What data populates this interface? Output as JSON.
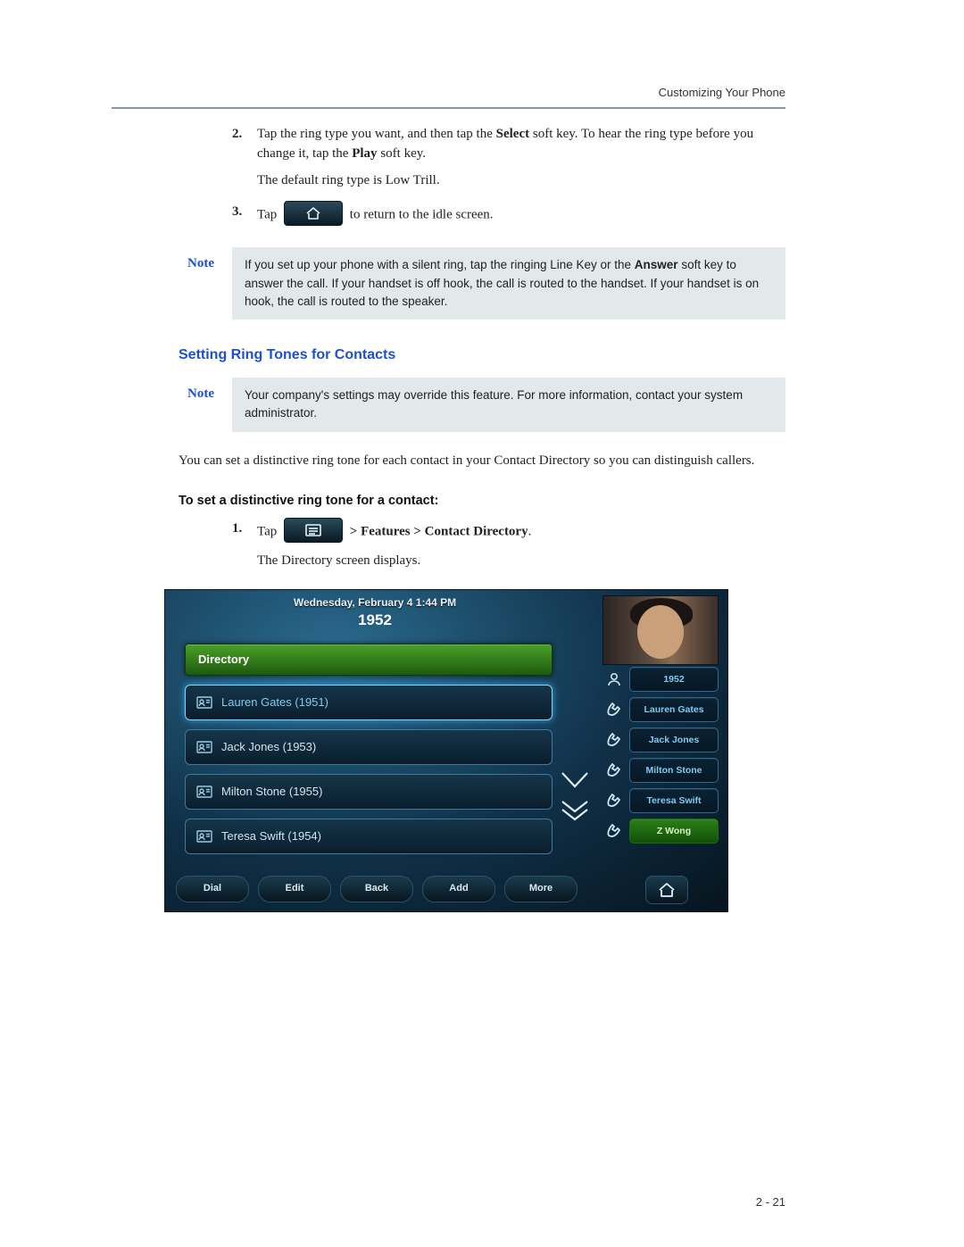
{
  "header": {
    "running": "Customizing Your Phone"
  },
  "step2": {
    "num": "2.",
    "line1_a": "Tap the ring type you want, and then tap the ",
    "line1_b": "Select",
    "line1_c": " soft key. To hear the ring type before you change it, tap the ",
    "line1_d": "Play",
    "line1_e": " soft key.",
    "line2": "The default ring type is Low Trill."
  },
  "step3": {
    "num": "3.",
    "pre": "Tap ",
    "post": " to return to the idle screen."
  },
  "note1": {
    "label": "Note",
    "a": "If you set up your phone with a silent ring, tap the ringing Line Key or the ",
    "b": "Answer",
    "c": " soft key to answer the call. If your handset is off hook, the call is routed to the handset. If your handset is on hook, the call is routed to the speaker."
  },
  "section": "Setting Ring Tones for Contacts",
  "note2": {
    "label": "Note",
    "text": "Your company's settings may override this feature. For more information, contact your system administrator."
  },
  "para1": "You can set a distinctive ring tone for each contact in your Contact Directory so you can distinguish callers.",
  "task": "To set a distinctive ring tone for a contact:",
  "stepA": {
    "num": "1.",
    "pre": "Tap ",
    "mid": " > Features > Contact Directory",
    "dot": ".",
    "line2": "The Directory screen displays."
  },
  "phone": {
    "datetime": "Wednesday, February 4  1:44 PM",
    "ext": "1952",
    "dir_header": "Directory",
    "contacts": [
      {
        "label": "Lauren Gates (1951)",
        "selected": true
      },
      {
        "label": "Jack Jones (1953)",
        "selected": false
      },
      {
        "label": "Milton Stone (1955)",
        "selected": false
      },
      {
        "label": "Teresa Swift (1954)",
        "selected": false
      }
    ],
    "lines": [
      {
        "label": "1952"
      },
      {
        "label": "Lauren Gates"
      },
      {
        "label": "Jack Jones"
      },
      {
        "label": "Milton Stone"
      },
      {
        "label": "Teresa Swift"
      },
      {
        "label": "Z Wong"
      }
    ],
    "softkeys": [
      "Dial",
      "Edit",
      "Back",
      "Add",
      "More"
    ]
  },
  "page_num": "2 - 21"
}
